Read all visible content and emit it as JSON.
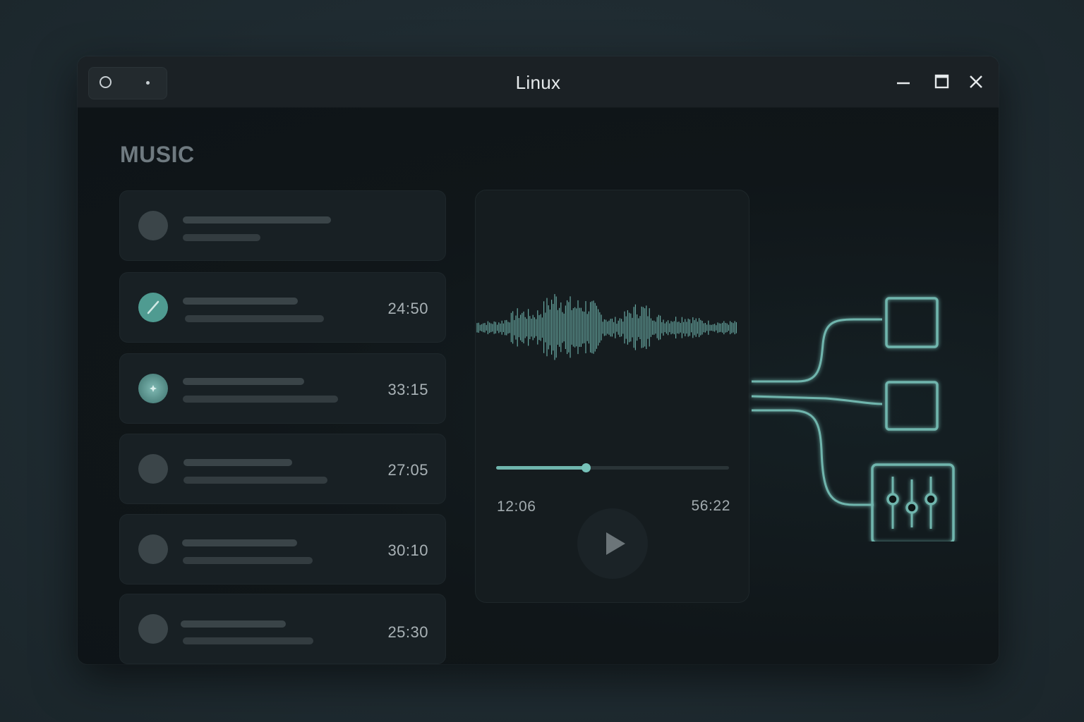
{
  "window": {
    "title": "Linux",
    "controls": [
      "minimize-icon",
      "maximize-icon",
      "close-icon"
    ]
  },
  "section": {
    "title": "MUSIC"
  },
  "tracks": [
    {
      "duration": "",
      "icon": "none"
    },
    {
      "duration": "24:50",
      "icon": "pencil-icon"
    },
    {
      "duration": "33:15",
      "icon": "sparkle-icon"
    },
    {
      "duration": "27:05",
      "icon": "none"
    },
    {
      "duration": "30:10",
      "icon": "none"
    },
    {
      "duration": "25:30",
      "icon": "none"
    }
  ],
  "player": {
    "elapsed": "12:06",
    "total": "56:22",
    "progress": 0.385
  },
  "routing": {
    "outputs": [
      "square-output-icon",
      "square-output-icon",
      "equalizer-icon"
    ]
  },
  "colors": {
    "accent": "#6fb5ad",
    "window_bg": "#0f1518",
    "card_bg": "#182024"
  }
}
